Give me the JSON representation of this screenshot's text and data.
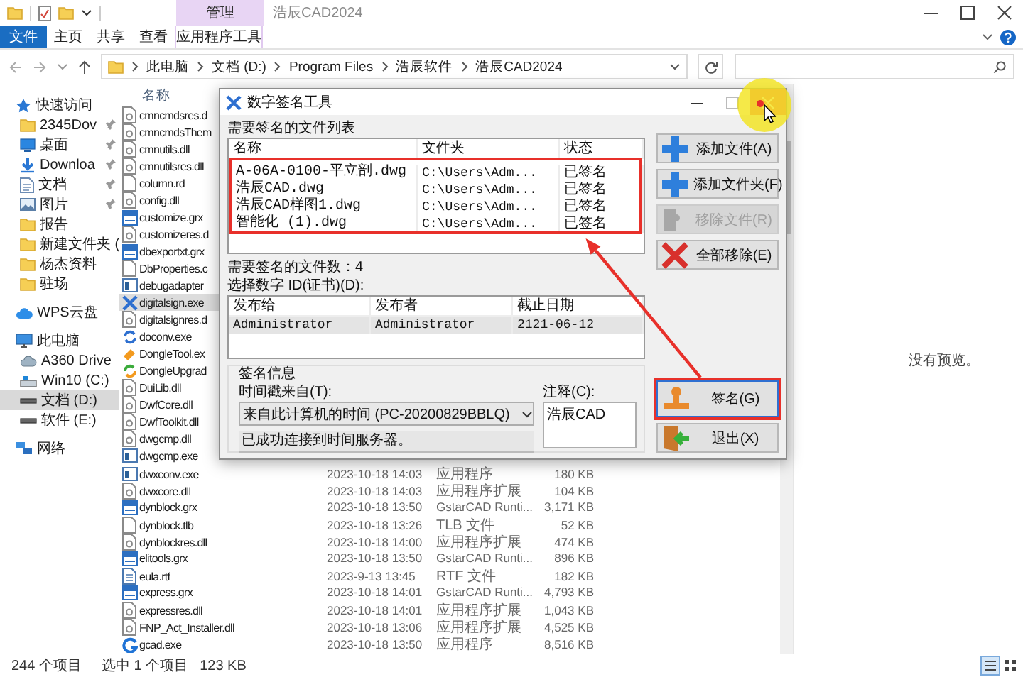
{
  "window": {
    "title": "浩辰CAD2024",
    "context_tab": "管理"
  },
  "ribbon": {
    "tabs": [
      {
        "label": "文件",
        "kind": "file"
      },
      {
        "label": "主页",
        "kind": "normal"
      },
      {
        "label": "共享",
        "kind": "normal"
      },
      {
        "label": "查看",
        "kind": "normal"
      },
      {
        "label": "应用程序工具",
        "kind": "contextual"
      }
    ]
  },
  "address": {
    "path": [
      "此电脑",
      "文档 (D:)",
      "Program Files",
      "浩辰软件",
      "浩辰CAD2024"
    ]
  },
  "navigation": {
    "items": [
      {
        "label": "快速访问",
        "kind": "star",
        "selected": false,
        "children": [
          {
            "label": "2345Dov",
            "kind": "folder",
            "pinned": true,
            "selected": false
          },
          {
            "label": "桌面",
            "kind": "desktop",
            "pinned": true,
            "selected": false
          },
          {
            "label": "Downloa",
            "kind": "download",
            "pinned": true,
            "selected": false
          },
          {
            "label": "文档",
            "kind": "documents",
            "pinned": true,
            "selected": false
          },
          {
            "label": "图片",
            "kind": "pictures",
            "pinned": true,
            "selected": false
          },
          {
            "label": "报告",
            "kind": "folder",
            "pinned": false,
            "selected": false
          },
          {
            "label": "新建文件夹 (",
            "kind": "folder",
            "pinned": false,
            "selected": false
          },
          {
            "label": "杨杰资料",
            "kind": "folder",
            "pinned": false,
            "selected": false
          },
          {
            "label": "驻场",
            "kind": "folder",
            "pinned": false,
            "selected": false
          }
        ]
      },
      {
        "label": "WPS云盘",
        "kind": "cloud",
        "selected": false
      },
      {
        "label": "此电脑",
        "kind": "computer",
        "selected": false,
        "children": [
          {
            "label": "A360 Drive",
            "kind": "cloud-drive",
            "selected": false
          },
          {
            "label": "Win10 (C:)",
            "kind": "system-drive",
            "selected": false
          },
          {
            "label": "文档 (D:)",
            "kind": "drive",
            "selected": true
          },
          {
            "label": "软件 (E:)",
            "kind": "drive",
            "selected": false
          }
        ]
      },
      {
        "label": "网络",
        "kind": "network",
        "selected": false
      }
    ]
  },
  "files": {
    "columns": [
      "名称"
    ],
    "rows": [
      {
        "name": "cmncmdsres.d",
        "kind": "dll",
        "selected": false
      },
      {
        "name": "cmncmdsThem",
        "kind": "dll",
        "selected": false
      },
      {
        "name": "cmnutils.dll",
        "kind": "dll",
        "selected": false
      },
      {
        "name": "cmnutilsres.dll",
        "kind": "dll",
        "selected": false
      },
      {
        "name": "column.rd",
        "kind": "blank",
        "selected": false
      },
      {
        "name": "config.dll",
        "kind": "dll",
        "selected": false
      },
      {
        "name": "customize.grx",
        "kind": "grx",
        "selected": false
      },
      {
        "name": "customizeres.d",
        "kind": "dll",
        "selected": false
      },
      {
        "name": "dbexportxt.grx",
        "kind": "grx",
        "selected": false
      },
      {
        "name": "DbProperties.c",
        "kind": "blank",
        "selected": false
      },
      {
        "name": "debugadapter",
        "kind": "exe",
        "selected": false
      },
      {
        "name": "digitalsign.exe",
        "kind": "tool",
        "selected": true
      },
      {
        "name": "digitalsignres.d",
        "kind": "dll",
        "selected": false
      },
      {
        "name": "doconv.exe",
        "kind": "convert",
        "selected": false
      },
      {
        "name": "DongleTool.ex",
        "kind": "dongle",
        "selected": false
      },
      {
        "name": "DongleUpgrad",
        "kind": "upgrade",
        "selected": false
      },
      {
        "name": "DuiLib.dll",
        "kind": "dll",
        "selected": false
      },
      {
        "name": "DwfCore.dll",
        "kind": "dll",
        "selected": false
      },
      {
        "name": "DwfToolkit.dll",
        "kind": "dll",
        "selected": false
      },
      {
        "name": "dwgcmp.dll",
        "kind": "dll",
        "selected": false
      },
      {
        "name": "dwgcmp.exe",
        "kind": "exe",
        "selected": false
      },
      {
        "name": "dwxconv.exe",
        "kind": "exe",
        "selected": false,
        "date": "2023-10-18 14:03",
        "type": "应用程序",
        "size": "180 KB"
      },
      {
        "name": "dwxcore.dll",
        "kind": "dll",
        "selected": false,
        "date": "2023-10-18 14:03",
        "type": "应用程序扩展",
        "size": "104 KB"
      },
      {
        "name": "dynblock.grx",
        "kind": "grx",
        "selected": false,
        "date": "2023-10-18 13:50",
        "type": "GstarCAD Runti...",
        "size": "3,171 KB"
      },
      {
        "name": "dynblock.tlb",
        "kind": "blank",
        "selected": false,
        "date": "2023-10-18 13:26",
        "type": "TLB 文件",
        "size": "52 KB"
      },
      {
        "name": "dynblockres.dll",
        "kind": "dll",
        "selected": false,
        "date": "2023-10-18 14:00",
        "type": "应用程序扩展",
        "size": "474 KB"
      },
      {
        "name": "elitools.grx",
        "kind": "grx",
        "selected": false,
        "date": "2023-10-18 13:50",
        "type": "GstarCAD Runti...",
        "size": "896 KB"
      },
      {
        "name": "eula.rtf",
        "kind": "rtf",
        "selected": false,
        "date": "2023-9-13 13:45",
        "type": "RTF 文件",
        "size": "182 KB"
      },
      {
        "name": "express.grx",
        "kind": "grx",
        "selected": false,
        "date": "2023-10-18 14:01",
        "type": "GstarCAD Runti...",
        "size": "4,793 KB"
      },
      {
        "name": "expressres.dll",
        "kind": "dll",
        "selected": false,
        "date": "2023-10-18 14:01",
        "type": "应用程序扩展",
        "size": "1,043 KB"
      },
      {
        "name": "FNP_Act_Installer.dll",
        "kind": "dll",
        "selected": false,
        "date": "2023-10-18 13:06",
        "type": "应用程序扩展",
        "size": "4,525 KB"
      },
      {
        "name": "gcad.exe",
        "kind": "gcad",
        "selected": false,
        "date": "2023-10-18 13:50",
        "type": "应用程序",
        "size": "8,516 KB"
      }
    ]
  },
  "preview": {
    "message": "没有预览。"
  },
  "status_bar": {
    "item_count": "244 个项目",
    "selection": "选中 1 个项目",
    "selection_size": "123 KB"
  },
  "dialog": {
    "title": "数字签名工具",
    "files_label": "需要签名的文件列表",
    "files": {
      "highlighted": true,
      "columns": [
        "名称",
        "文件夹",
        "状态"
      ],
      "rows": [
        {
          "name": "A-06A-0100-平立剖.dwg",
          "folder": "C:\\Users\\Adm...",
          "status": "已签名"
        },
        {
          "name": "浩辰CAD.dwg",
          "folder": "C:\\Users\\Adm...",
          "status": "已签名"
        },
        {
          "name": "浩辰CAD样图1.dwg",
          "folder": "C:\\Users\\Adm...",
          "status": "已签名"
        },
        {
          "name": "智能化 (1).dwg",
          "folder": "C:\\Users\\Adm...",
          "status": "已签名"
        }
      ]
    },
    "file_count": "需要签名的文件数：4",
    "certificate_label": "选择数字 ID(证书)(D):",
    "certificates": {
      "columns": [
        "发布给",
        "发布者",
        "截止日期"
      ],
      "rows": [
        {
          "issued_to": "Administrator",
          "issuer": "Administrator",
          "expires": "2121-06-12",
          "selected": true
        }
      ]
    },
    "sign_info": {
      "title": "签名信息",
      "timestamp_label": "时间戳来自(T):",
      "timestamp_value": "来自此计算机的时间 (PC-20200829BBLQ)",
      "timestamp_status": "已成功连接到时间服务器。",
      "comment_label": "注释(C):",
      "comment": "浩辰CAD"
    },
    "file_buttons": [
      {
        "label": "添加文件(A)",
        "kind": "add",
        "disabled": false,
        "highlighted": false
      },
      {
        "label": "添加文件夹(F)",
        "kind": "add",
        "disabled": false,
        "highlighted": false
      },
      {
        "label": "移除文件(R)",
        "kind": "remove",
        "disabled": true,
        "highlighted": false
      },
      {
        "label": "全部移除(E)",
        "kind": "remove_all",
        "disabled": false,
        "highlighted": false
      }
    ],
    "action_buttons": [
      {
        "label": "签名(G)",
        "kind": "sign",
        "disabled": false,
        "highlighted": true
      },
      {
        "label": "退出(X)",
        "kind": "exit",
        "disabled": false,
        "highlighted": false
      }
    ]
  }
}
